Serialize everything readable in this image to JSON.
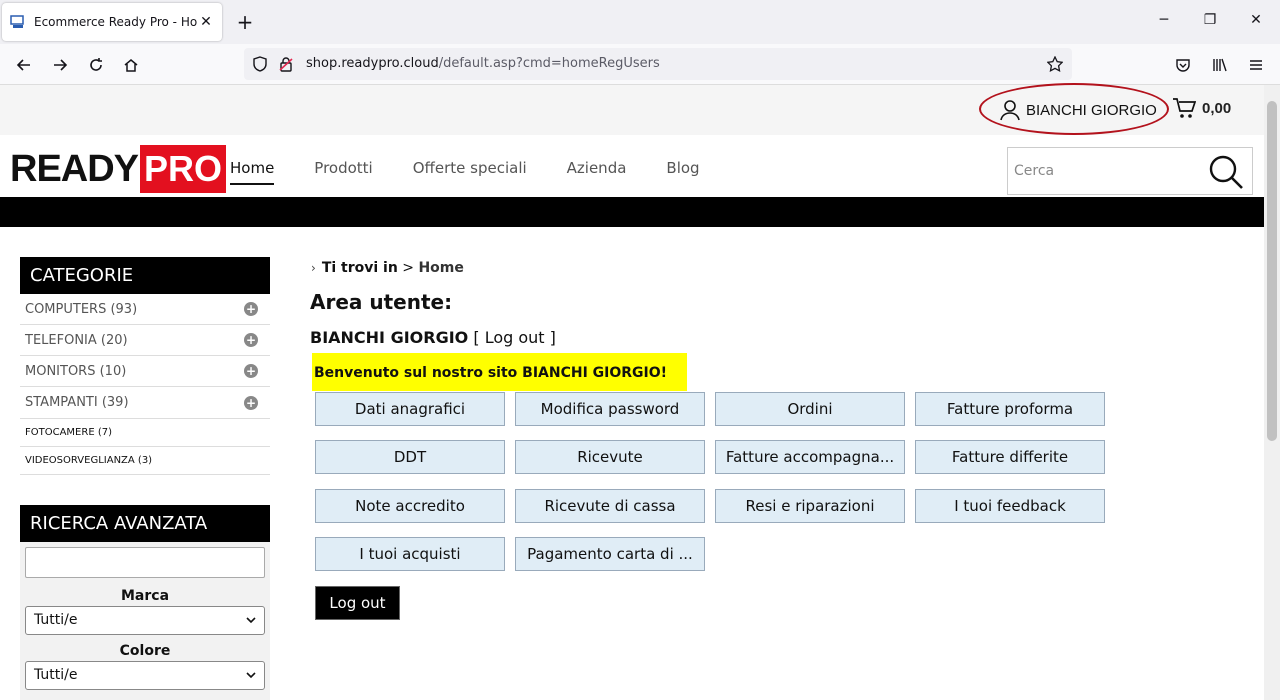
{
  "browser": {
    "tab_title": "Ecommerce Ready Pro - Home",
    "tab_close": "✕",
    "new_tab": "+",
    "url_host": "shop.readypro.cloud",
    "url_path": "/default.asp?cmd=homeRegUsers"
  },
  "topbar": {
    "user_name": "BIANCHI GIORGIO",
    "cart_total": "0,00"
  },
  "header": {
    "logo_ready": "READY",
    "logo_pro": "PRO",
    "nav": [
      "Home",
      "Prodotti",
      "Offerte speciali",
      "Azienda",
      "Blog"
    ],
    "search_placeholder": "Cerca"
  },
  "sidebar": {
    "categories_title": "CATEGORIE",
    "categories": [
      {
        "label": "COMPUTERS (93)",
        "expandable": true
      },
      {
        "label": "TELEFONIA (20)",
        "expandable": true
      },
      {
        "label": "MONITORS (10)",
        "expandable": true
      },
      {
        "label": "STAMPANTI (39)",
        "expandable": true
      },
      {
        "label": "FOTOCAMERE (7)",
        "expandable": false
      },
      {
        "label": "VIDEOSORVEGLIANZA (3)",
        "expandable": false
      }
    ],
    "advanced_title": "RICERCA AVANZATA",
    "brand_label": "Marca",
    "brand_value": "Tutti/e",
    "color_label": "Colore",
    "color_value": "Tutti/e"
  },
  "main": {
    "breadcrumb_prefix": "Ti trovi in",
    "breadcrumb_sep": ">",
    "breadcrumb_current": "Home",
    "title": "Area utente:",
    "user_name": "BIANCHI GIORGIO",
    "logout_link": "[ Log out ]",
    "welcome": "Benvenuto sul nostro sito BIANCHI GIORGIO!",
    "buttons": [
      "Dati anagrafici",
      "Modifica password",
      "Ordini",
      "Fatture proforma",
      "DDT",
      "Ricevute",
      "Fatture accompagna...",
      "Fatture differite",
      "Note accredito",
      "Ricevute di cassa",
      "Resi e riparazioni",
      "I tuoi feedback",
      "I tuoi acquisti",
      "Pagamento carta di ..."
    ],
    "logout_button": "Log out"
  },
  "colors": {
    "accent_red": "#e3101f",
    "highlight_yellow": "#ffff00",
    "button_bg": "#e0edf6"
  }
}
